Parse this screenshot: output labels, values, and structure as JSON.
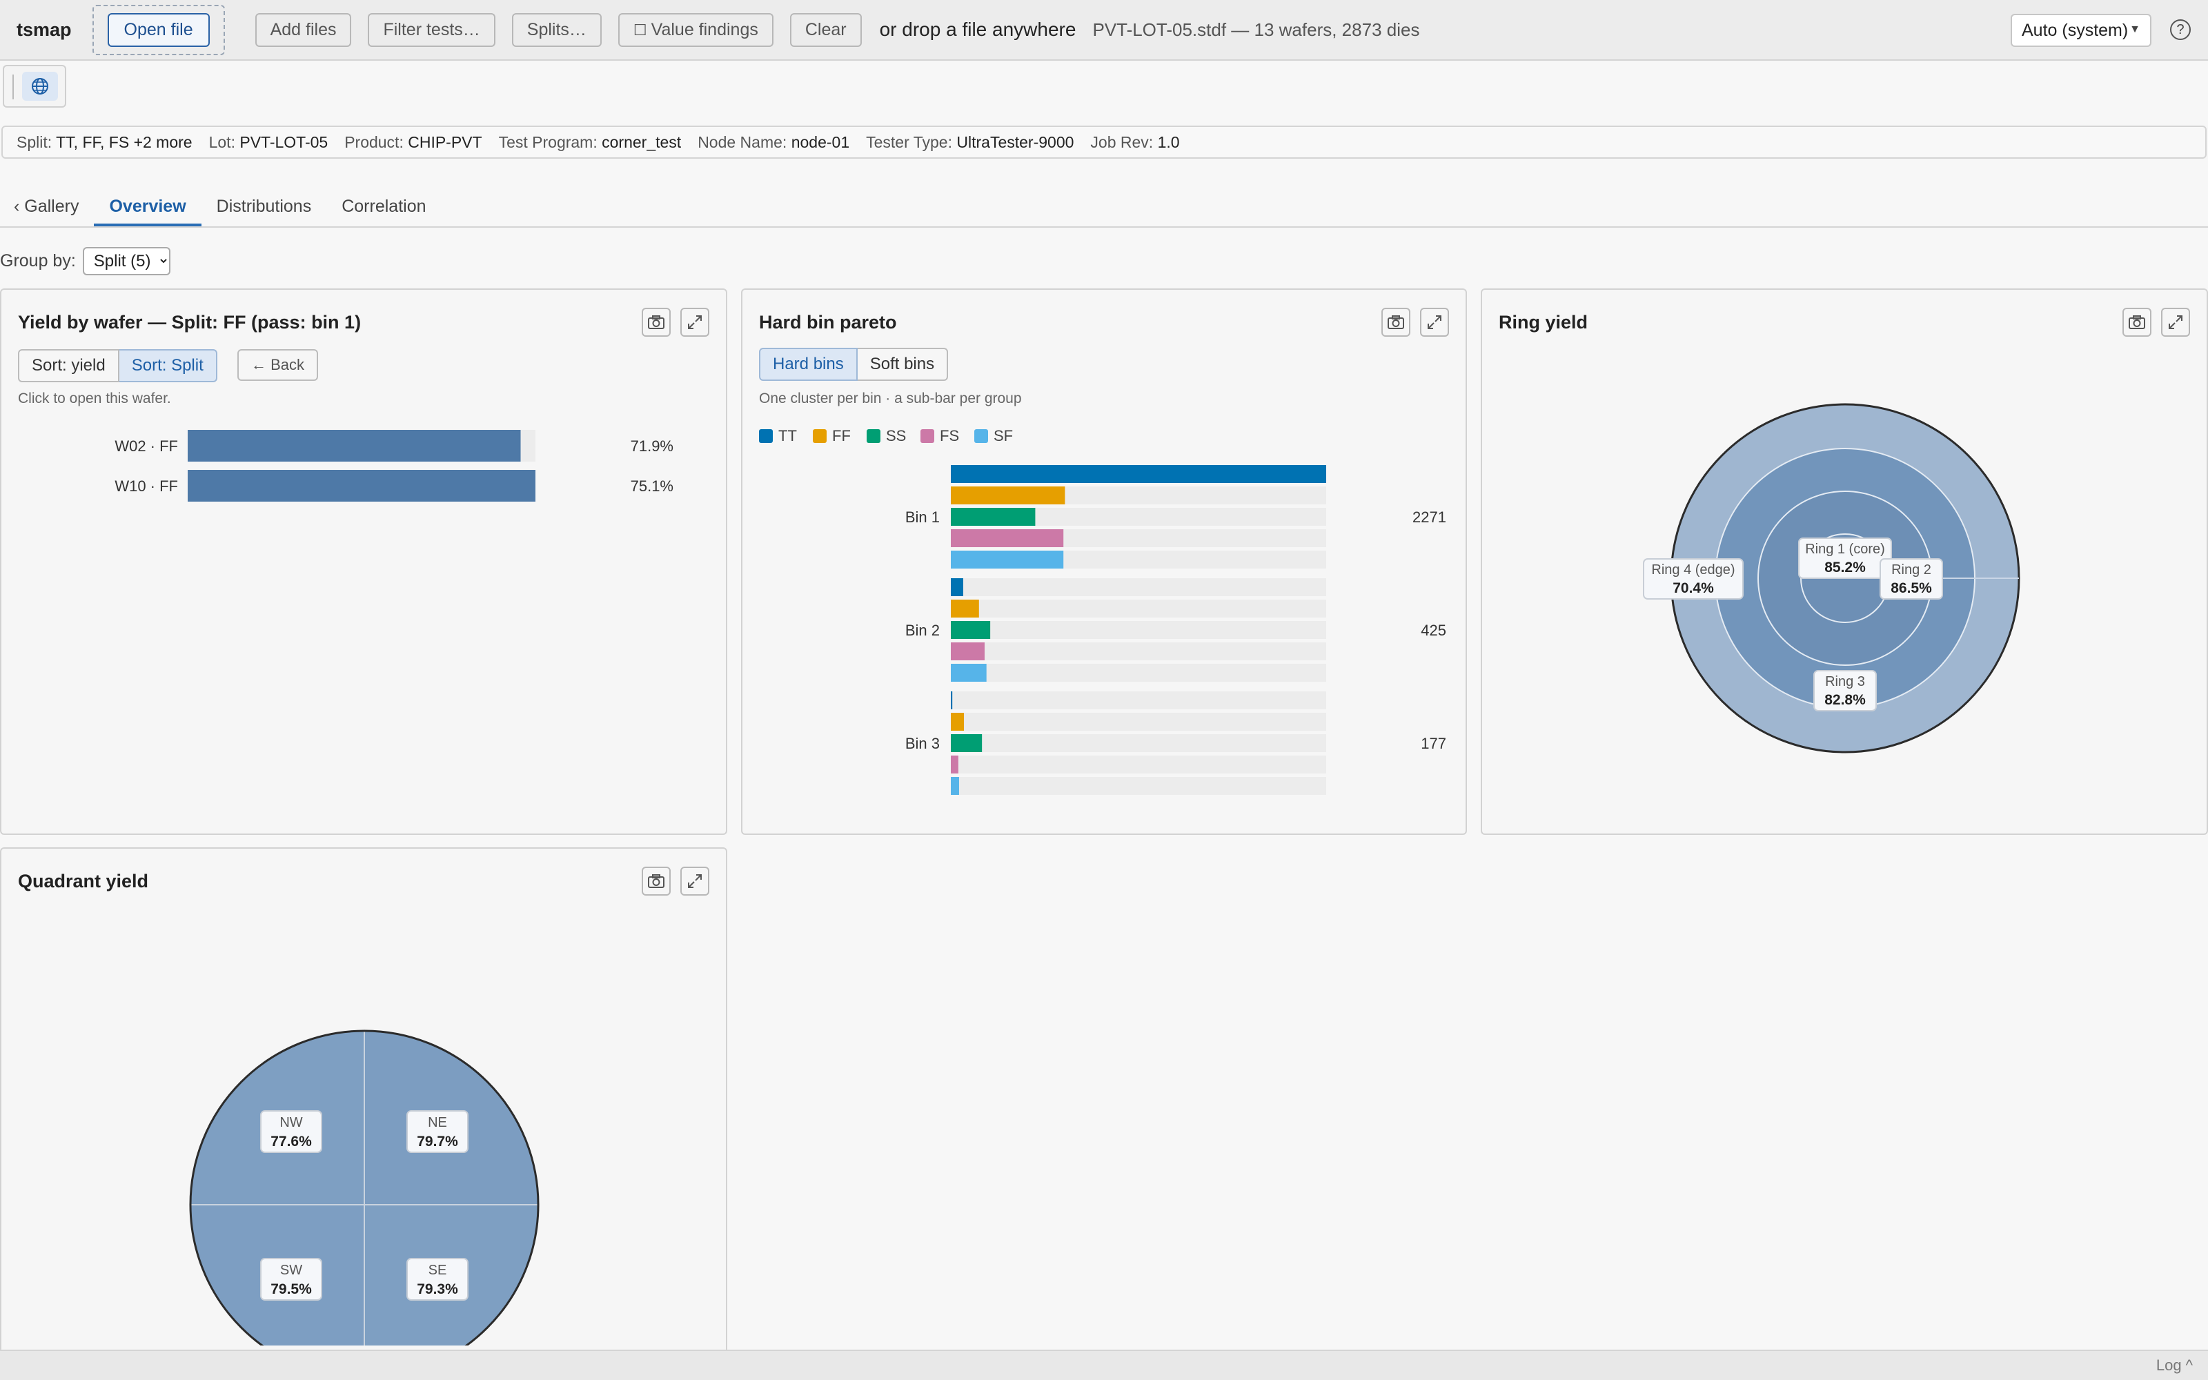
{
  "toolbar": {
    "app_name": "tsmap",
    "open_file": "Open file",
    "add_files": "Add files",
    "filter_tests": "Filter tests…",
    "splits": "Splits…",
    "value_findings": "Value findings",
    "clear": "Clear",
    "drop_text": "or drop a file anywhere",
    "file_info": "PVT-LOT-05.stdf — 13 wafers, 2873 dies",
    "theme": "Auto (system)",
    "help": "?"
  },
  "meta": [
    {
      "key": "Split:",
      "value": "TT, FF, FS +2 more"
    },
    {
      "key": "Lot:",
      "value": "PVT-LOT-05"
    },
    {
      "key": "Product:",
      "value": "CHIP-PVT"
    },
    {
      "key": "Test Program:",
      "value": "corner_test"
    },
    {
      "key": "Node Name:",
      "value": "node-01"
    },
    {
      "key": "Tester Type:",
      "value": "UltraTester-9000"
    },
    {
      "key": "Job Rev:",
      "value": "1.0"
    }
  ],
  "tabs": {
    "gallery": "‹ Gallery",
    "overview": "Overview",
    "distributions": "Distributions",
    "correlation": "Correlation"
  },
  "groupby": {
    "label": "Group by:",
    "value": "Split (5)"
  },
  "yield_panel": {
    "title": "Yield by wafer — Split: FF (pass: bin 1)",
    "sort_yield": "Sort: yield",
    "sort_split": "Sort: Split",
    "back": "← Back",
    "hint": "Click to open this wafer."
  },
  "pareto_panel": {
    "title": "Hard bin pareto",
    "hard_bins": "Hard bins",
    "soft_bins": "Soft bins",
    "hint": "One cluster per bin · a sub-bar per group"
  },
  "ring_panel": {
    "title": "Ring yield"
  },
  "quadrant_panel": {
    "title": "Quadrant yield"
  },
  "log": "Log ^",
  "chart_data": [
    {
      "type": "bar",
      "orientation": "horizontal",
      "categories": [
        "W02 · FF",
        "W10 · FF"
      ],
      "values": [
        71.9,
        75.1
      ],
      "value_labels": [
        "71.9%",
        "75.1%"
      ],
      "unit": "%",
      "xlim": [
        0,
        75.1
      ],
      "color": "#4e79a7"
    },
    {
      "type": "bar",
      "orientation": "horizontal",
      "categories": [
        "Bin 1",
        "Bin 2",
        "Bin 3"
      ],
      "totals": [
        2271,
        425,
        177
      ],
      "series": [
        {
          "name": "TT",
          "color": "#0072b2",
          "values": [
            1000,
            33,
            4
          ]
        },
        {
          "name": "FF",
          "color": "#e69f00",
          "values": [
            304,
            75,
            35
          ]
        },
        {
          "name": "SS",
          "color": "#009e73",
          "values": [
            225,
            105,
            83
          ]
        },
        {
          "name": "FS",
          "color": "#cc79a7",
          "values": [
            300,
            90,
            20
          ]
        },
        {
          "name": "SF",
          "color": "#56b4e9",
          "values": [
            300,
            95,
            22
          ]
        }
      ],
      "legend": "top-left",
      "xlim": [
        0,
        1000
      ]
    },
    {
      "type": "pie",
      "layout": "concentric-rings",
      "labels": [
        "Ring 1 (core)",
        "Ring 2",
        "Ring 3",
        "Ring 4 (edge)"
      ],
      "values": [
        85.2,
        86.5,
        82.8,
        70.4
      ],
      "value_labels": [
        "85.2%",
        "86.5%",
        "82.8%",
        "70.4%"
      ],
      "colors": [
        "#6d8fb5",
        "#6d8fb5",
        "#7295bb",
        "#9fb6d0"
      ]
    },
    {
      "type": "pie",
      "layout": "quadrants",
      "labels": [
        "NW",
        "NE",
        "SW",
        "SE"
      ],
      "values": [
        77.6,
        79.7,
        79.5,
        79.3
      ],
      "value_labels": [
        "77.6%",
        "79.7%",
        "79.5%",
        "79.3%"
      ],
      "colors": [
        "#7e9fc2",
        "#7c9dc1",
        "#7d9ec2",
        "#7e9fc2"
      ]
    }
  ]
}
